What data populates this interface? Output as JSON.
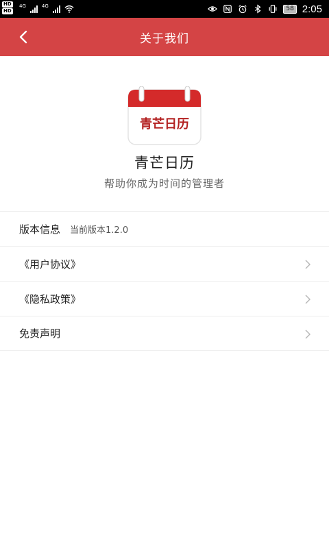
{
  "status_bar": {
    "sim1_badge": "HD",
    "sim2_badge": "HD",
    "net1": "4G",
    "net2": "4G",
    "battery": "58",
    "time": "2:05",
    "icons": [
      "eye-icon",
      "nfc-icon",
      "alarm-icon",
      "bluetooth-icon",
      "vibrate-icon",
      "battery-icon"
    ]
  },
  "header": {
    "title": "关于我们",
    "back_icon": "chevron-left-icon"
  },
  "app": {
    "logo_text": "青芒日历",
    "name": "青芒日历",
    "slogan": "帮助你成为时间的管理者"
  },
  "menu": {
    "items": [
      {
        "label": "版本信息",
        "value": "当前版本1.2.0"
      },
      {
        "label": "《用户协议》"
      },
      {
        "label": "《隐私政策》"
      },
      {
        "label": "免责声明"
      }
    ]
  },
  "colors": {
    "header_bg": "#d44445",
    "logo_red": "#d42a2a",
    "logo_text": "#b32020"
  }
}
